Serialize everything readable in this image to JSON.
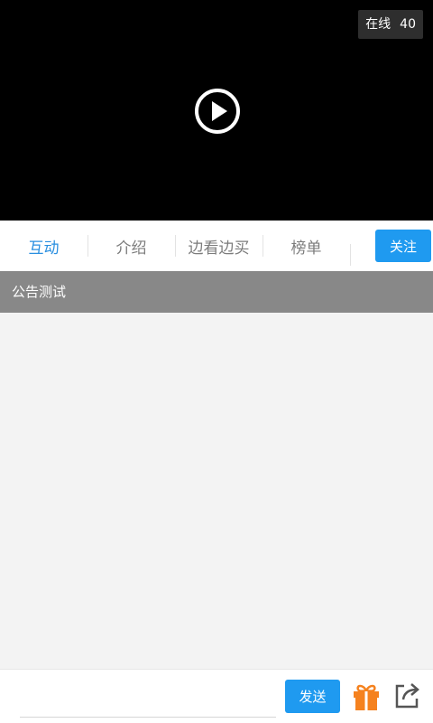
{
  "video": {
    "online_label": "在线",
    "online_count": "40",
    "play_icon": "play-icon"
  },
  "tabs": [
    {
      "label": "互动",
      "active": true
    },
    {
      "label": "介绍",
      "active": false
    },
    {
      "label": "边看边买",
      "active": false
    },
    {
      "label": "榜单",
      "active": false
    }
  ],
  "follow_label": "关注",
  "notice_text": "公告测试",
  "bottom": {
    "input_value": "",
    "send_label": "发送",
    "gift_icon": "gift-icon",
    "share_icon": "share-icon"
  },
  "colors": {
    "accent": "#1f9af0",
    "active_tab": "#2a8fe0",
    "gift": "#f5821f"
  }
}
